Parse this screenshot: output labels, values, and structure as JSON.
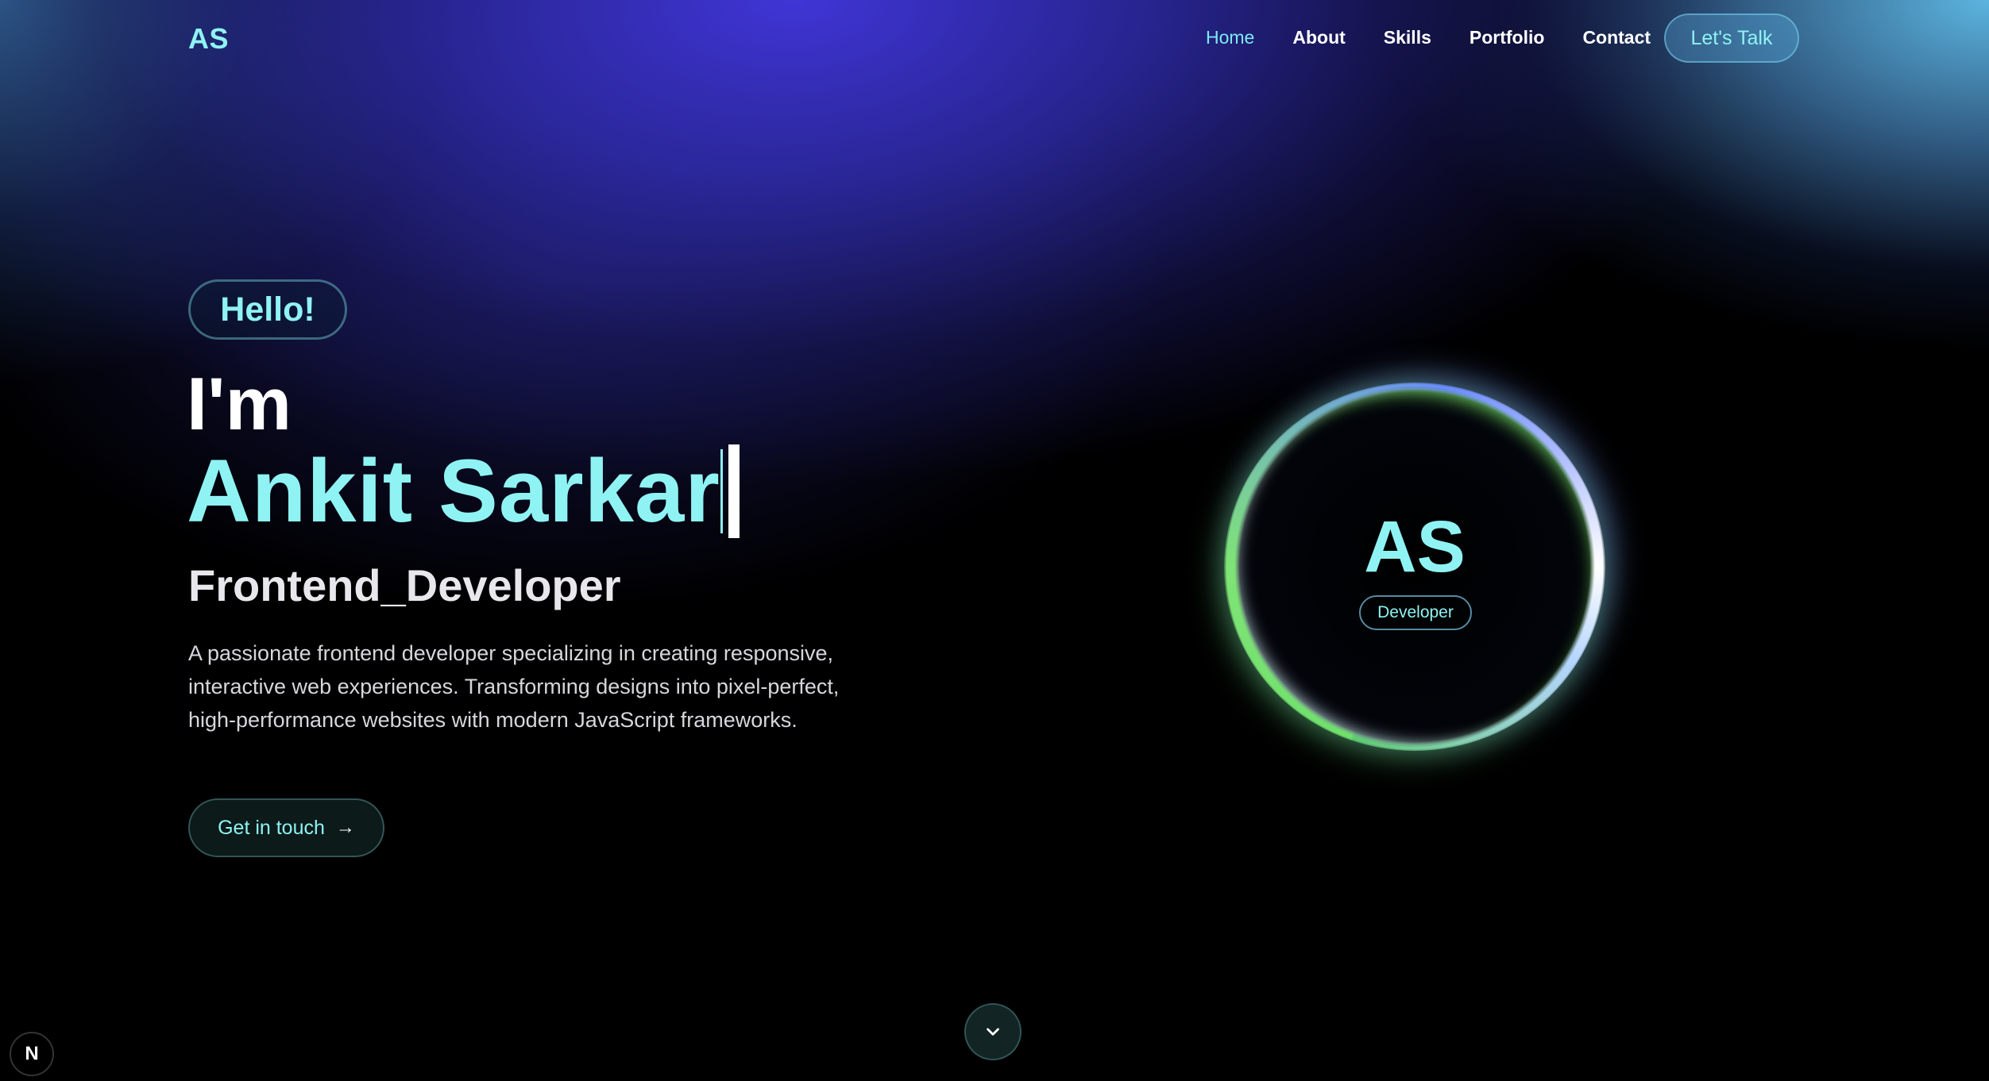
{
  "nav": {
    "logo": "AS",
    "links": [
      "Home",
      "About",
      "Skills",
      "Portfolio",
      "Contact"
    ],
    "active": "Home",
    "cta": "Let's Talk"
  },
  "hero": {
    "greeting": "Hello!",
    "intro": "I'm",
    "name": "Ankit Sarkar",
    "role": "Frontend_Developer",
    "description": "A passionate frontend developer specializing in creating responsive, interactive web experiences. Transforming designs into pixel-perfect, high-performance websites with modern JavaScript frameworks.",
    "button": "Get in touch"
  },
  "avatar": {
    "initials": "AS",
    "badge": "Developer"
  },
  "icons": {
    "arrow": "arrow-right-icon",
    "scroll": "chevron-down-icon",
    "corner": "N"
  },
  "colors": {
    "accent": "#8ff3f3",
    "background": "#000000",
    "glow_blue": "#4338e1"
  }
}
